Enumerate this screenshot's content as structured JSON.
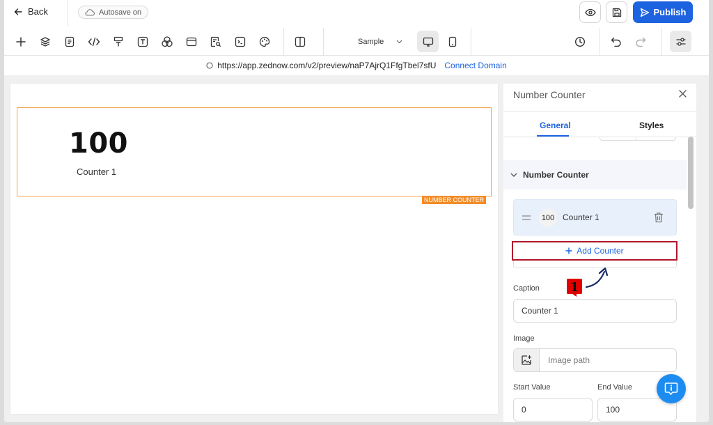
{
  "header": {
    "back_label": "Back",
    "autosave_label": "Autosave on",
    "publish_label": "Publish",
    "accent_color": "#1d63e0"
  },
  "toolbar": {
    "tools": [
      "add-icon",
      "layers-icon",
      "page-icon",
      "code-icon",
      "paint-roller-icon",
      "text-icon",
      "shapes-icon",
      "window-icon",
      "search-doc-icon",
      "terminal-icon",
      "palette-icon",
      "columns-icon"
    ],
    "page_select": "Sample",
    "devices": [
      "desktop-icon",
      "mobile-icon"
    ],
    "actions": [
      "history-icon",
      "undo-icon",
      "redo-icon",
      "settings-icon"
    ]
  },
  "url_bar": {
    "url": "https://app.zednow.com/v2/preview/naP7AjrQ1FfgTbel7sfU",
    "connect_label": "Connect Domain"
  },
  "canvas": {
    "counter_value": "100",
    "counter_caption": "Counter 1",
    "selection_tag": "NUMBER COUNTER",
    "selection_color": "#f28c28"
  },
  "panel": {
    "title": "Number Counter",
    "tabs": [
      {
        "label": "General",
        "active": true
      },
      {
        "label": "Styles",
        "active": false
      }
    ],
    "section_title": "Number Counter",
    "counter_item": {
      "badge": "100",
      "label": "Counter 1"
    },
    "add_counter_label": "Add Counter",
    "caption": {
      "label": "Caption",
      "value": "Counter 1"
    },
    "image": {
      "label": "Image",
      "placeholder": "Image path"
    },
    "start_value": {
      "label": "Start Value",
      "value": "0"
    },
    "end_value": {
      "label": "End Value",
      "value": "100"
    }
  },
  "annotation": {
    "step_number": "1",
    "highlight_color": "#b0162a"
  }
}
